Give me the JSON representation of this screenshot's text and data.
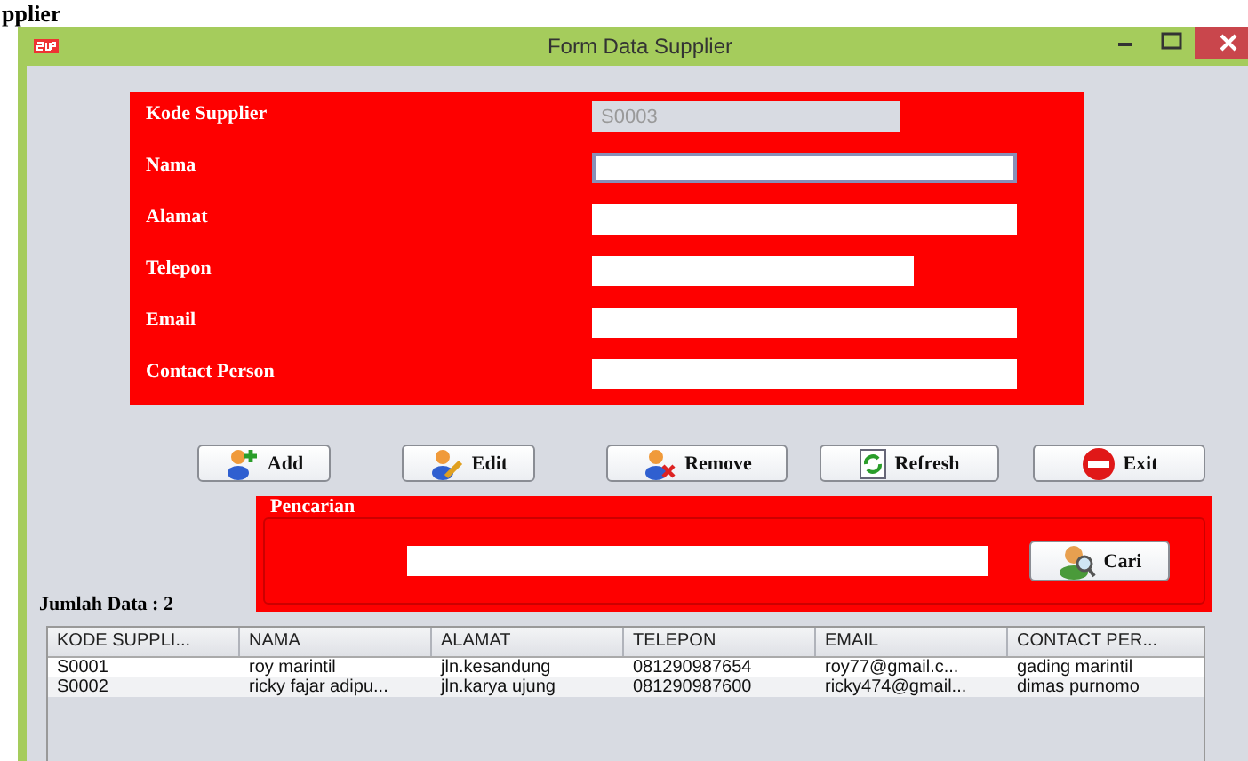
{
  "page_heading": "pplier",
  "window": {
    "title": "Form Data Supplier"
  },
  "form": {
    "fields": [
      {
        "label": "Kode Supplier",
        "value": "S0003",
        "disabled": true,
        "focused": false,
        "kind": "medium"
      },
      {
        "label": "Nama",
        "disabled": false,
        "focused": true,
        "kind": "long"
      },
      {
        "label": "Alamat",
        "disabled": false,
        "focused": false,
        "kind": "long"
      },
      {
        "label": "Telepon",
        "disabled": false,
        "focused": false,
        "kind": "medium"
      },
      {
        "label": "Email",
        "disabled": false,
        "focused": false,
        "kind": "long"
      },
      {
        "label": "Contact Person",
        "disabled": false,
        "focused": false,
        "kind": "long"
      }
    ]
  },
  "buttons": [
    {
      "label": "Add",
      "kind": "add"
    },
    {
      "label": "Edit",
      "kind": "edit"
    },
    {
      "label": "Remove",
      "kind": "remove"
    },
    {
      "label": "Refresh",
      "kind": "refresh"
    },
    {
      "label": "Exit",
      "kind": "exit"
    }
  ],
  "search": {
    "title": "Pencarian",
    "button": "Cari"
  },
  "count_label": "Jumlah Data : 2",
  "table": {
    "columns": [
      "KODE SUPPLI...",
      "NAMA",
      "ALAMAT",
      "TELEPON",
      "EMAIL",
      "CONTACT PER..."
    ],
    "rows": [
      [
        "S0001",
        "roy marintil",
        "jln.kesandung",
        "081290987654",
        "roy77@gmail.c...",
        "gading marintil"
      ],
      [
        "S0002",
        "ricky fajar adipu...",
        "jln.karya ujung",
        "081290987600",
        "ricky474@gmail...",
        "dimas purnomo"
      ]
    ]
  }
}
